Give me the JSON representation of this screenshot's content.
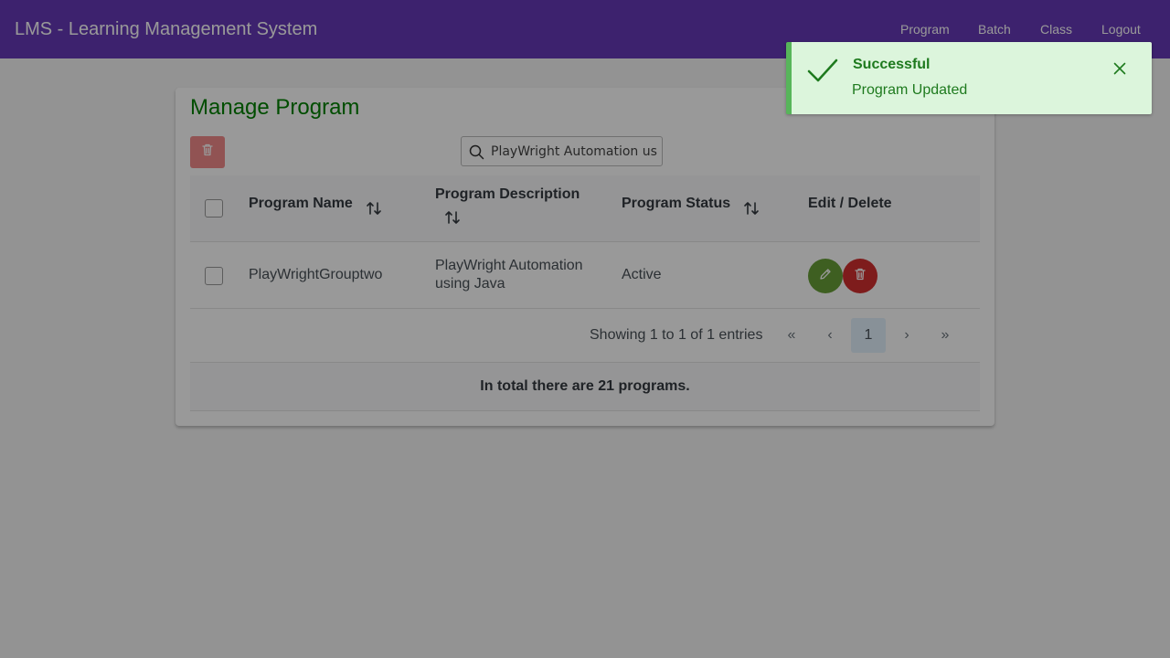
{
  "app": {
    "title": "LMS - Learning Management System"
  },
  "nav": {
    "items": [
      {
        "label": "Program"
      },
      {
        "label": "Batch"
      },
      {
        "label": "Class"
      },
      {
        "label": "Logout"
      }
    ]
  },
  "page": {
    "title": "Manage Program"
  },
  "search": {
    "value": "PlayWright Automation us"
  },
  "table": {
    "columns": [
      {
        "label": "Program Name",
        "sortable": true
      },
      {
        "label": "Program Description",
        "sortable": true
      },
      {
        "label": "Program Status",
        "sortable": true
      },
      {
        "label": "Edit / Delete",
        "sortable": false
      }
    ],
    "rows": [
      {
        "name": "PlayWrightGrouptwo",
        "description_line1": "PlayWright Automation",
        "description_line2": "using Java",
        "status": "Active"
      }
    ]
  },
  "paginator": {
    "report": "Showing 1 to 1 of 1 entries",
    "current_page": "1",
    "first": "«",
    "prev": "‹",
    "next": "›",
    "last": "»"
  },
  "footer": {
    "summary": "In total there are 21 programs."
  },
  "toast": {
    "summary": "Successful",
    "detail": "Program Updated"
  },
  "colors": {
    "navbar": "#673ab7",
    "title": "#008000",
    "edit": "#689f38",
    "delete": "#d32f2f",
    "toast_border": "#57b55a"
  },
  "icons": {
    "bulk_delete": "trash-icon",
    "search": "search-icon",
    "sort": "sort-icon",
    "edit": "pencil-icon",
    "delete": "trash-icon",
    "toast_status": "check-icon",
    "toast_close": "close-icon"
  }
}
